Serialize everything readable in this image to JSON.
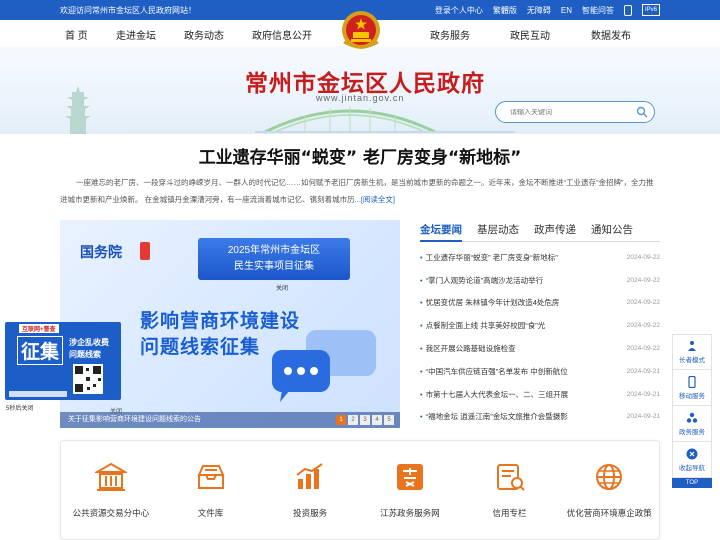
{
  "topbar": {
    "welcome": "欢迎访问常州市金坛区人民政府网站！",
    "links": [
      "登录个人中心",
      "繁體版",
      "无障碍",
      "EN",
      "智能问答"
    ],
    "ipv6": "IPv6"
  },
  "nav": {
    "items": [
      "首 页",
      "走进金坛",
      "政务动态",
      "政府信息公开",
      "政务服务",
      "政民互动",
      "数据发布"
    ]
  },
  "banner": {
    "title": "常州市金坛区人民政府",
    "domain": "www.jintan.gov.cn",
    "search_placeholder": "请输入关键词"
  },
  "headline": {
    "title": "工业遗存华丽“蜕变” 老厂房变身“新地标”",
    "summary": "一座难忘的老厂房、一段穿斗过的峥嵘岁月、一群人的时代记忆……如何赋予老旧厂房新生机，是当前城市更新的命题之一。近年来，金坛不断推进“工业遗存”金招牌”，全力推进城市更新和产业焕新。 在金城镇丹金溧漕河旁，有一座流淌着城市记忆、镌刻着城市历...",
    "read_more": "[阅读全文]"
  },
  "slide": {
    "gwy": "国务院",
    "header_line1": "2025年常州市金坛区",
    "header_line2": "民生实事项目征集",
    "close_label": "关闭",
    "big_line1": "影响营商环境建设",
    "big_line2": "问题线索征集",
    "close_label2": "关闭",
    "caption": "关于征集影响营商环境建设问题线索的公告",
    "pages": [
      "1",
      "2",
      "3",
      "4",
      "5"
    ],
    "active_page": 0
  },
  "float_ad": {
    "tag": "互联网+督查",
    "big": "征集",
    "line1": "涉企乱收费",
    "line2": "问题线索",
    "close": "5秒后关闭"
  },
  "news": {
    "tabs": [
      "金坛要闻",
      "基层动态",
      "政声传递",
      "通知公告"
    ],
    "active_tab": 0,
    "items": [
      {
        "title": "工业遗存华丽“蜕变” 老厂房变身“新地标”",
        "date": "2024-09-22"
      },
      {
        "title": "“掌门人观势论道”高端沙龙活动举行",
        "date": "2024-09-22"
      },
      {
        "title": "忧居变优居 朱林镇今年计划改造4处危房",
        "date": "2024-09-22"
      },
      {
        "title": "点餐制全面上线 共享美好校园“食”光",
        "date": "2024-09-22"
      },
      {
        "title": "我区开展公路基础设施检查",
        "date": "2024-09-22"
      },
      {
        "title": "“中国汽车供应链百强”名单发布 中创新航位",
        "date": "2024-09-21"
      },
      {
        "title": "市第十七届人大代表金坛一、二、三组开展",
        "date": "2024-09-21"
      },
      {
        "title": "“福地金坛 逍遥江南”金坛文旅推介会暨摄影",
        "date": "2024-09-21"
      }
    ]
  },
  "services": [
    {
      "label": "公共资源交易分中心",
      "icon": "building-icon"
    },
    {
      "label": "文件库",
      "icon": "inbox-icon"
    },
    {
      "label": "投资服务",
      "icon": "chart-icon"
    },
    {
      "label": "江苏政务服务网",
      "icon": "su-logo-icon"
    },
    {
      "label": "信用专栏",
      "icon": "credit-icon"
    },
    {
      "label": "优化营商环境惠企政策",
      "icon": "globe-icon"
    }
  ],
  "right_float": {
    "items": [
      "长者模式",
      "移动服务",
      "政务服务",
      "收起导航"
    ],
    "top": "TOP"
  },
  "colors": {
    "primary": "#1f5fc4",
    "title_red": "#c81c1c",
    "service_orange": "#e8741e"
  }
}
